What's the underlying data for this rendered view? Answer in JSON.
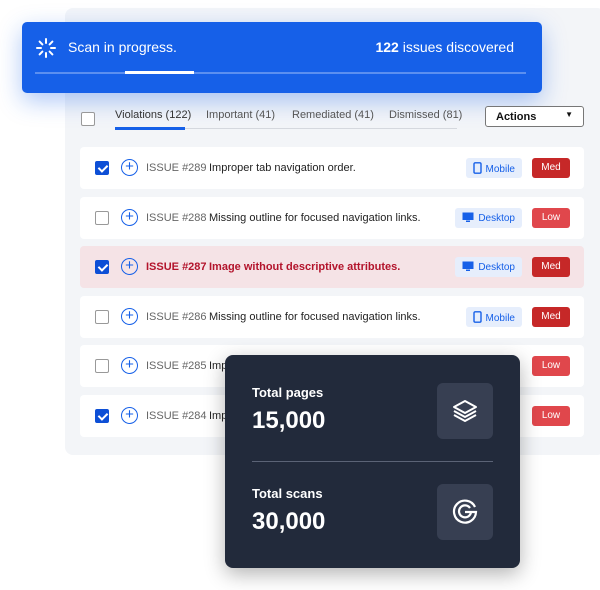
{
  "banner": {
    "title": "Scan in progress.",
    "count": "122",
    "count_suffix": " issues discovered",
    "progress_percent": 20
  },
  "tabs": [
    {
      "label": "Violations (122)"
    },
    {
      "label": "Important (41)"
    },
    {
      "label": "Remediated (41)"
    },
    {
      "label": "Dismissed (81)"
    }
  ],
  "actions_label": "Actions",
  "rows": [
    {
      "id": "ISSUE #289",
      "desc": "Improper tab navigation order.",
      "device": "Mobile",
      "severity": "Med",
      "checked": true
    },
    {
      "id": "ISSUE #288",
      "desc": "Missing outline for focused navigation links.",
      "device": "Desktop",
      "severity": "Low",
      "checked": false
    },
    {
      "id": "ISSUE #287",
      "desc": "Image without descriptive attributes.",
      "device": "Desktop",
      "severity": "Med",
      "checked": true,
      "highlighted": true
    },
    {
      "id": "ISSUE #286",
      "desc": "Missing outline for focused navigation links.",
      "device": "Mobile",
      "severity": "Med",
      "checked": false
    },
    {
      "id": "ISSUE #285",
      "desc": "Imp",
      "severity": "Low",
      "checked": false
    },
    {
      "id": "ISSUE #284",
      "desc": "Imp",
      "severity": "Low",
      "checked": true
    }
  ],
  "colors": {
    "accent": "#1660e8",
    "med": "#c62828",
    "low": "#e0474c",
    "card": "#222a3b"
  },
  "stats": {
    "pages_label": "Total pages",
    "pages_value": "15,000",
    "pages_icon": "layers-icon",
    "scans_label": "Total scans",
    "scans_value": "30,000",
    "scans_icon": "g-logo-icon"
  }
}
